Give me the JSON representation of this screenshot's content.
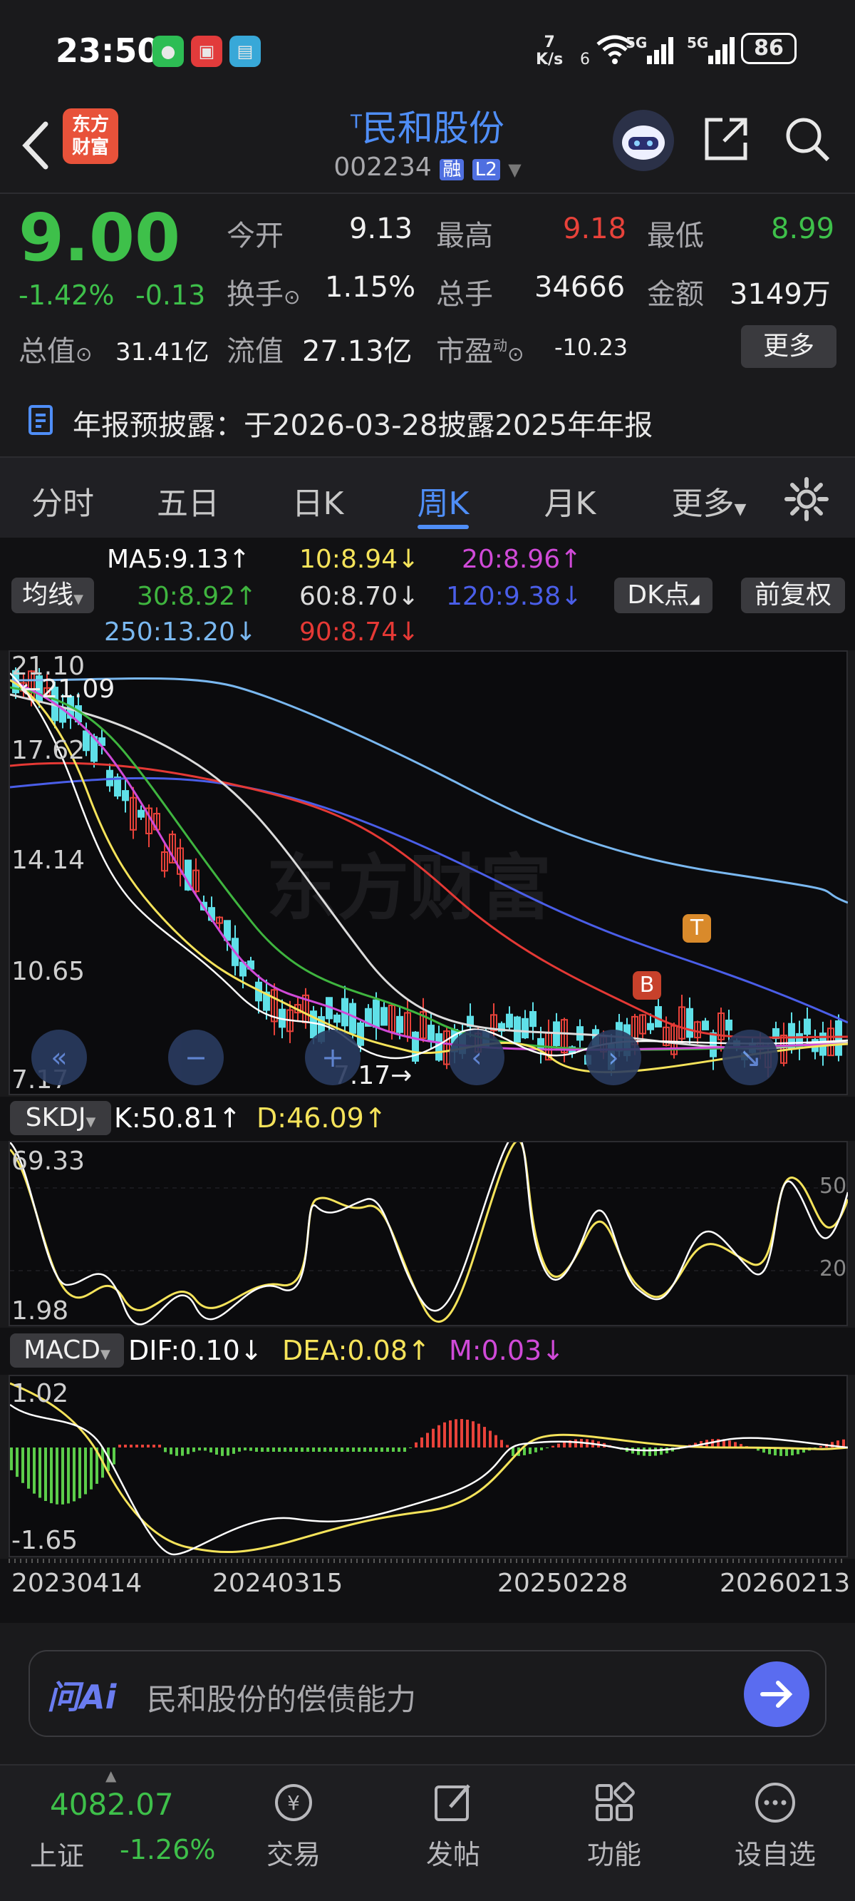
{
  "status_bar": {
    "time": "23:50",
    "net_speed_top": "7",
    "net_speed_unit": "K/s",
    "wifi_label": "6",
    "sim1": "5G",
    "sim2": "5G",
    "battery": "86"
  },
  "header": {
    "logo_text_1": "东方",
    "logo_text_2": "财富",
    "title_mark": "T",
    "title": "民和股份",
    "code": "002234",
    "badge_rong": "融",
    "badge_l2": "L2"
  },
  "quote": {
    "price": "9.00",
    "change_pct": "-1.42%",
    "change_abs": "-0.13",
    "open_label": "今开",
    "open": "9.13",
    "high_label": "最高",
    "high": "9.18",
    "low_label": "最低",
    "low": "8.99",
    "turnover_label": "换手",
    "turnover": "1.15%",
    "volume_label": "总手",
    "volume": "34666",
    "amount_label": "金额",
    "amount": "3149万",
    "mktcap_label": "总值",
    "mktcap": "31.41亿",
    "float_label": "流值",
    "float_cap": "27.13亿",
    "pe_label": "市盈",
    "pe_sup": "动",
    "pe": "-10.23",
    "more_label": "更多"
  },
  "notice": {
    "text": "年报预披露：于2026-03-28披露2025年年报"
  },
  "tabs": [
    {
      "label": "分时",
      "active": false
    },
    {
      "label": "五日",
      "active": false
    },
    {
      "label": "日K",
      "active": false
    },
    {
      "label": "周K",
      "active": true
    },
    {
      "label": "月K",
      "active": false
    },
    {
      "label": "更多",
      "active": false
    }
  ],
  "ma": {
    "selector": "均线",
    "ma5": "MA5:9.13↑",
    "ma10": "10:8.94↓",
    "ma20": "20:8.96↑",
    "ma30": "30:8.92↑",
    "ma60": "60:8.70↓",
    "ma120": "120:9.38↓",
    "ma250": "250:13.20↓",
    "ma90": "90:8.74↓",
    "dk_label": "DK点",
    "fq_label": "前复权",
    "colors": {
      "ma5": "#ffffff",
      "ma10": "#f5e35a",
      "ma20": "#d04ad8",
      "ma30": "#3fb53f",
      "ma60": "#dcdcdc",
      "ma120": "#4a5ee8",
      "ma250": "#7ab8f0",
      "ma90": "#e53935"
    }
  },
  "kline": {
    "y_labels": [
      "21.10",
      "17.62",
      "14.14",
      "10.65",
      "7.17"
    ],
    "max_label": "21.09",
    "min_label": "7.17",
    "watermark": "东方财富",
    "marker_b": "B",
    "marker_t": "T"
  },
  "skdj": {
    "selector": "SKDJ",
    "k": "K:50.81↑",
    "d": "D:46.09↑",
    "y_top": "69.33",
    "y_bot": "1.98",
    "ref_hi": "50",
    "ref_lo": "20"
  },
  "macd": {
    "selector": "MACD",
    "dif": "DIF:0.10↓",
    "dea": "DEA:0.08↑",
    "m": "M:0.03↓",
    "y_top": "1.02",
    "y_bot": "-1.65"
  },
  "dates": [
    "20230414",
    "20240315",
    "20250228",
    "20260213"
  ],
  "ask": {
    "logo": "问Ai",
    "placeholder": "民和股份的偿债能力"
  },
  "bottom_nav": {
    "index_value": "4082.07",
    "index_name": "上证",
    "index_change": "-1.26%",
    "items": [
      {
        "label": "交易",
        "icon": "exchange-icon"
      },
      {
        "label": "发帖",
        "icon": "edit-icon"
      },
      {
        "label": "功能",
        "icon": "grid-icon"
      },
      {
        "label": "设自选",
        "icon": "more-dots-icon"
      }
    ]
  }
}
